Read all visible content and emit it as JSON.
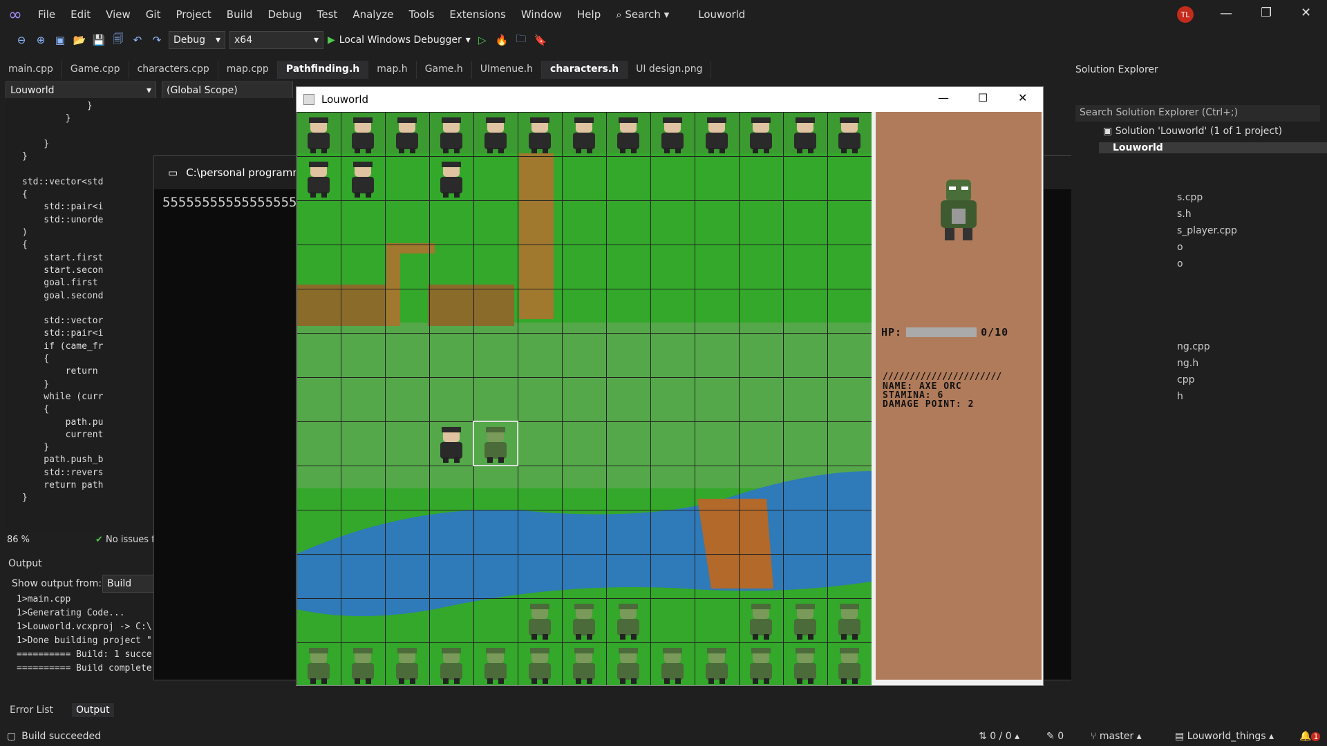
{
  "menu": {
    "items": [
      "File",
      "Edit",
      "View",
      "Git",
      "Project",
      "Build",
      "Debug",
      "Test",
      "Analyze",
      "Tools",
      "Extensions",
      "Window",
      "Help"
    ],
    "search": "Search",
    "solution_title": "Louworld",
    "avatar": "TL"
  },
  "toolbar": {
    "config": "Debug",
    "platform": "x64",
    "run": "Local Windows Debugger"
  },
  "tabs": [
    {
      "label": "main.cpp",
      "active": false
    },
    {
      "label": "Game.cpp",
      "active": false
    },
    {
      "label": "characters.cpp",
      "active": false
    },
    {
      "label": "map.cpp",
      "active": false
    },
    {
      "label": "Pathfinding.h",
      "active": true
    },
    {
      "label": "map.h",
      "active": false
    },
    {
      "label": "Game.h",
      "active": false
    },
    {
      "label": "UImenue.h",
      "active": false
    },
    {
      "label": "characters.h",
      "active": true
    },
    {
      "label": "UI design.png",
      "active": false
    }
  ],
  "editor": {
    "project": "Louworld",
    "scope": "(Global Scope)",
    "zoom": "86 %",
    "issues": "No issues f",
    "lines": [
      "            }",
      "        }",
      "",
      "    }",
      "}",
      "",
      "std::vector<std",
      "{",
      "    std::pair<i",
      "    std::unorde",
      ")",
      "{",
      "    start.first",
      "    start.secon",
      "    goal.first",
      "    goal.second",
      "",
      "    std::vector",
      "    std::pair<i",
      "    if (came_fr",
      "    {",
      "        return",
      "    }",
      "    while (curr",
      "    {",
      "        path.pu",
      "        current",
      "    }",
      "    path.push_b",
      "    std::revers",
      "    return path",
      "}"
    ]
  },
  "output": {
    "title": "Output",
    "show_from": "Show output from:",
    "source": "Build",
    "lines": [
      "1>main.cpp",
      "1>Generating Code...",
      "1>Louworld.vcxproj -> C:\\",
      "1>Done building project \"",
      "========== Build: 1 succe",
      "========== Build complete"
    ],
    "tabs": [
      "Error List",
      "Output"
    ]
  },
  "console": {
    "title": "C:\\personal programm",
    "text": "55555555555555555"
  },
  "game": {
    "title": "Louworld",
    "hp_label": "HP:",
    "hp_value": "0/10",
    "hp_fraction": 0.0,
    "divider": "//////////////////////",
    "name": "NAME: AXE ORC",
    "stamina": "STAMINA: 6",
    "damage": "DAMAGE POINT: 2"
  },
  "solution": {
    "title": "Solution Explorer",
    "search": "Search Solution Explorer (Ctrl+;)",
    "root": "Solution 'Louworld' (1 of 1 project)",
    "project": "Louworld",
    "files": [
      "s.cpp",
      "s.h",
      "s_player.cpp",
      "o",
      "o",
      "ng.cpp",
      "ng.h",
      "cpp",
      "h"
    ]
  },
  "status": {
    "left": "Build succeeded",
    "counts": "0 / 0",
    "pencil": "0",
    "branch": "master",
    "repo": "Louworld_things",
    "notif": "1"
  }
}
